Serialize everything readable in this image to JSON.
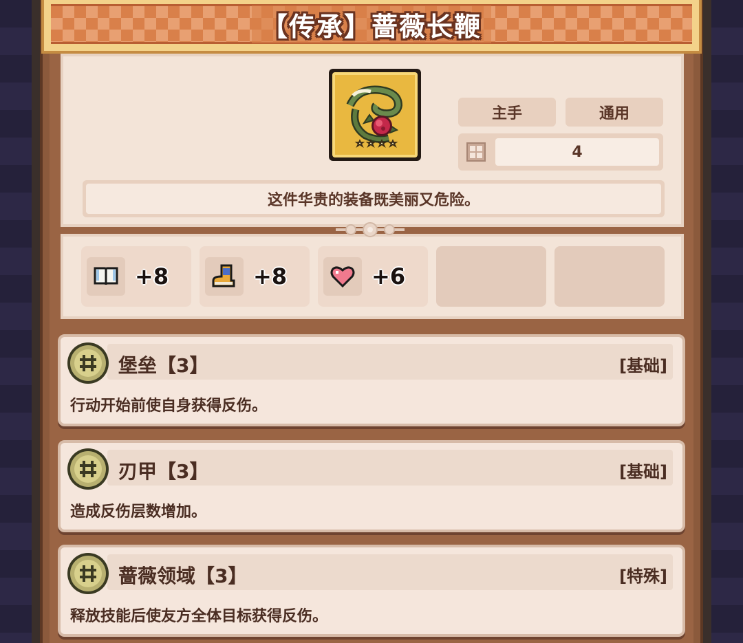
{
  "title": "【传承】蔷薇长鞭",
  "item": {
    "icon": "rose-whip-icon",
    "tags": [
      "主手",
      "通用"
    ],
    "slot_value": "4",
    "description": "这件华贵的装备既美丽又危险。"
  },
  "stats": [
    {
      "icon": "book-icon",
      "value": "+8"
    },
    {
      "icon": "boot-icon",
      "value": "+8"
    },
    {
      "icon": "heart-icon",
      "value": "+6"
    }
  ],
  "skills": [
    {
      "name": "堡垒【3】",
      "type": "[基础]",
      "description": "行动开始前使自身获得反伤。"
    },
    {
      "name": "刃甲【3】",
      "type": "[基础]",
      "description": "造成反伤层数增加。"
    },
    {
      "name": "蔷薇领域【3】",
      "type": "[特殊]",
      "description": "释放技能后使友方全体目标获得反伤。"
    }
  ],
  "colors": {
    "banner": "#d9804a",
    "card": "#f3e4d8",
    "text": "#5a3628",
    "frame": "#8b5a3c"
  }
}
